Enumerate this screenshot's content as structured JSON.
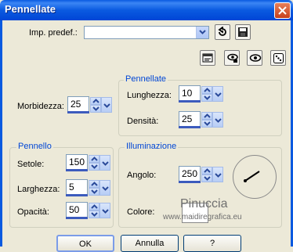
{
  "window": {
    "title": "Pennellate"
  },
  "preset": {
    "label": "Imp. predef.:",
    "value": ""
  },
  "morbidezza": {
    "label": "Morbidezza:",
    "value": "25"
  },
  "pennellate_group": {
    "title": "Pennellate",
    "lunghezza": {
      "label": "Lunghezza:",
      "value": "10"
    },
    "densita": {
      "label": "Densità:",
      "value": "25"
    }
  },
  "pennello_group": {
    "title": "Pennello",
    "setole": {
      "label": "Setole:",
      "value": "150"
    },
    "larghezza": {
      "label": "Larghezza:",
      "value": "5"
    },
    "opacita": {
      "label": "Opacità:",
      "value": "50"
    }
  },
  "illuminazione_group": {
    "title": "Illuminazione",
    "angolo": {
      "label": "Angolo:",
      "value": "250"
    },
    "colore": {
      "label": "Colore:",
      "swatch": "#ffffff"
    }
  },
  "buttons": {
    "ok": "OK",
    "cancel": "Annulla",
    "help": "?"
  },
  "watermark": {
    "line1": "Pinuccia",
    "line2": "www.maidiregrafica.eu"
  },
  "icons": [
    "close-icon",
    "chevron-down-icon",
    "undo-icon",
    "save-icon",
    "preview-icon",
    "lock-eye-icon",
    "eye-icon",
    "dice-icon"
  ]
}
